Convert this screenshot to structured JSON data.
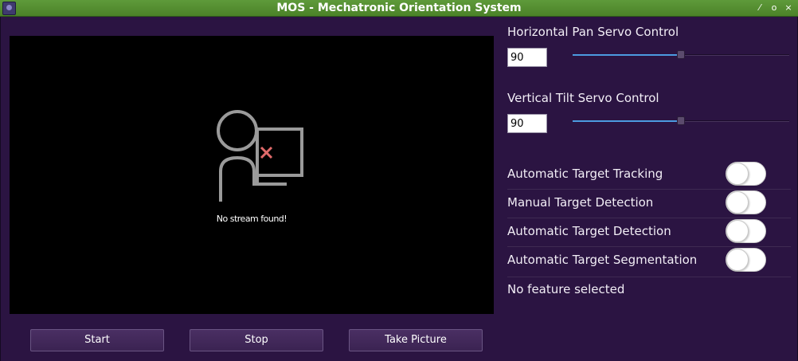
{
  "window": {
    "title": "MOS - Mechatronic Orientation System",
    "controls": {
      "minimize": "⁄",
      "maximize": "o",
      "close": "×"
    }
  },
  "video": {
    "placeholder_text": "No stream found!",
    "icon": "person-monitor-error-icon"
  },
  "buttons": {
    "start": "Start",
    "stop": "Stop",
    "take_picture": "Take Picture"
  },
  "pan": {
    "label": "Horizontal Pan Servo Control",
    "value": "90",
    "slider_fraction": 0.5
  },
  "tilt": {
    "label": "Vertical Tilt Servo Control",
    "value": "90",
    "slider_fraction": 0.5
  },
  "features": [
    {
      "label": "Automatic Target Tracking",
      "on": false
    },
    {
      "label": "Manual Target Detection",
      "on": false
    },
    {
      "label": "Automatic Target Detection",
      "on": false
    },
    {
      "label": "Automatic Target Segmentation",
      "on": false
    }
  ],
  "status_text": "No feature selected",
  "colors": {
    "titlebar": "#4b8228",
    "background": "#2b1442",
    "slider_fill": "#4c9be0",
    "error_x": "#e06a6a"
  }
}
